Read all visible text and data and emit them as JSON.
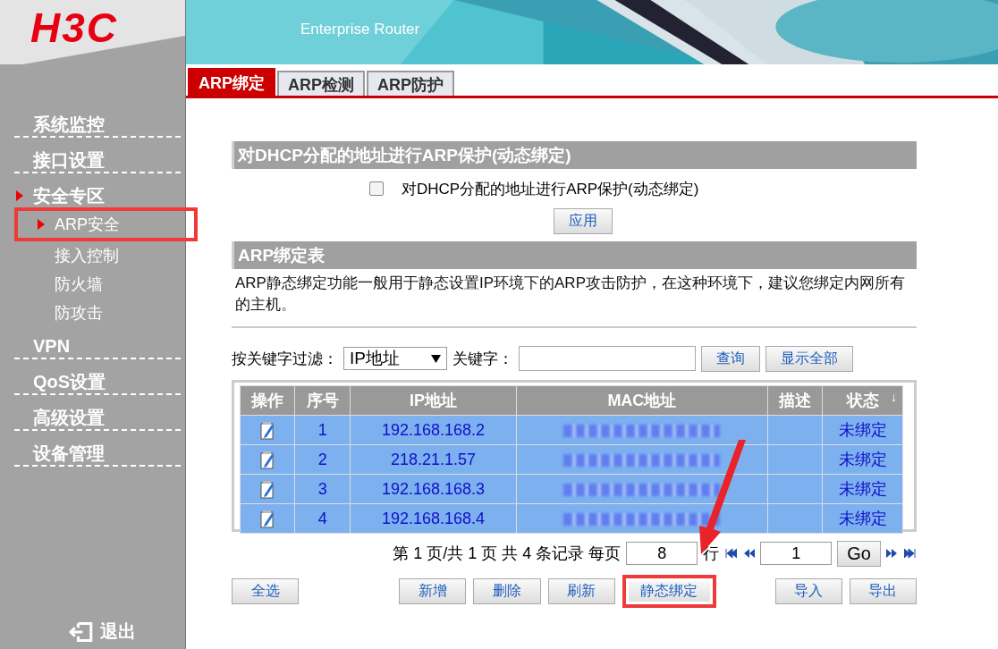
{
  "logo": "H3C",
  "banner": {
    "subtitle": "Enterprise Router"
  },
  "tabs": [
    {
      "label": "ARP绑定",
      "selected": true
    },
    {
      "label": "ARP检测",
      "selected": false
    },
    {
      "label": "ARP防护",
      "selected": false
    }
  ],
  "sidebar": {
    "items": [
      {
        "label": "系统监控",
        "expanded": false
      },
      {
        "label": "接口设置",
        "expanded": false
      },
      {
        "label": "安全专区",
        "expanded": true,
        "children": [
          {
            "label": "ARP安全",
            "selected": true
          },
          {
            "label": "接入控制",
            "selected": false
          },
          {
            "label": "防火墙",
            "selected": false
          },
          {
            "label": "防攻击",
            "selected": false
          }
        ]
      },
      {
        "label": "VPN",
        "expanded": false
      },
      {
        "label": "QoS设置",
        "expanded": false
      },
      {
        "label": "高级设置",
        "expanded": false
      },
      {
        "label": "设备管理",
        "expanded": false
      }
    ],
    "logout": "退出"
  },
  "dhcp_section": {
    "title": "对DHCP分配的地址进行ARP保护(动态绑定)",
    "checkbox": {
      "label": "对DHCP分配的地址进行ARP保护(动态绑定)",
      "checked": false
    },
    "apply_button": "应用"
  },
  "binding_section": {
    "title": "ARP绑定表",
    "description": "ARP静态绑定功能一般用于静态设置IP环境下的ARP攻击防护，在这种环境下，建议您绑定内网所有的主机。"
  },
  "filter": {
    "label": "按关键字过滤：",
    "select_value": "IP地址",
    "keyword_label": "关键字：",
    "query_button": "查询",
    "show_all_button": "显示全部"
  },
  "table": {
    "columns": [
      "操作",
      "序号",
      "IP地址",
      "MAC地址",
      "描述",
      "状态"
    ],
    "sort_mark": "↓",
    "rows": [
      {
        "index": "1",
        "ip": "192.168.168.2",
        "status": "未绑定"
      },
      {
        "index": "2",
        "ip": "218.21.1.57",
        "status": "未绑定"
      },
      {
        "index": "3",
        "ip": "192.168.168.3",
        "status": "未绑定"
      },
      {
        "index": "4",
        "ip": "192.168.168.4",
        "status": "未绑定"
      }
    ]
  },
  "pagination": {
    "text": "第 1 页/共 1 页 共 4 条记录 每页",
    "per_page": "8",
    "rows_label": "行",
    "page": "1",
    "go": "Go"
  },
  "buttons": [
    {
      "label": "全选",
      "highlighted": false
    },
    {
      "label": "新增",
      "highlighted": false
    },
    {
      "label": "删除",
      "highlighted": false
    },
    {
      "label": "刷新",
      "highlighted": false
    },
    {
      "label": "静态绑定",
      "highlighted": true
    },
    {
      "label": "导入",
      "highlighted": false
    },
    {
      "label": "导出",
      "highlighted": false
    }
  ]
}
